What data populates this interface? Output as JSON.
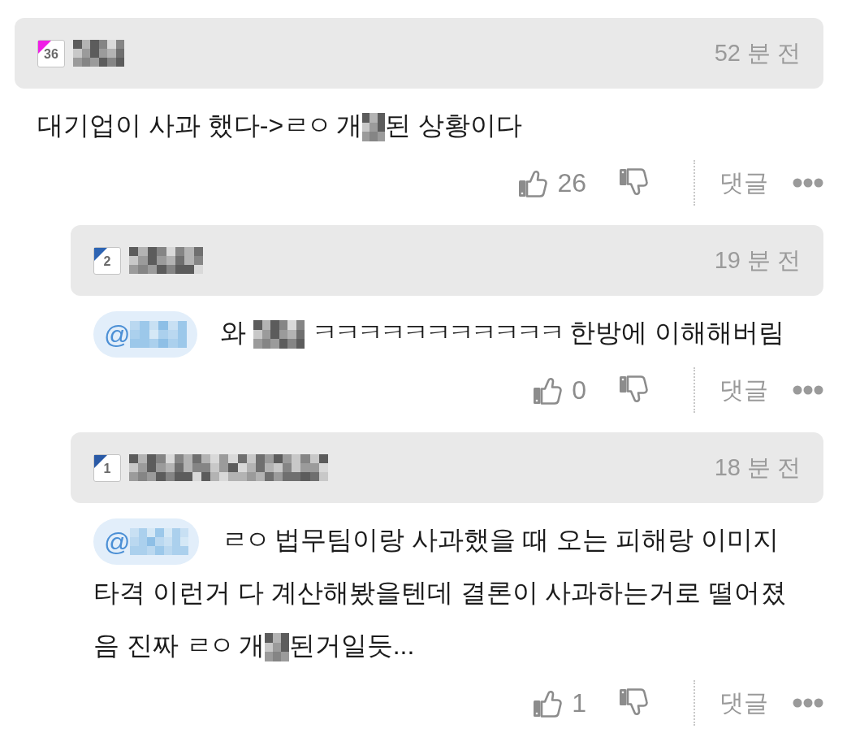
{
  "comments": [
    {
      "badge": {
        "text": "36",
        "color": "#f01ee6"
      },
      "time": "52 분 전",
      "body": [
        {
          "kind": "text",
          "text": "대기업이 사과 했다->ㄹㅇ 개"
        },
        {
          "kind": "mosaic"
        },
        {
          "kind": "text",
          "text": "된 상황이다"
        }
      ],
      "likes": "26",
      "reply_label": "댓글",
      "children": [
        {
          "badge": {
            "text": "2",
            "color": "#2d64b3"
          },
          "time": "19 분 전",
          "body": [
            {
              "kind": "mention",
              "text": "@"
            },
            {
              "kind": "text",
              "text": "와 "
            },
            {
              "kind": "mosaic"
            },
            {
              "kind": "text",
              "text": " ㅋㅋㅋㅋㅋㅋㅋㅋㅋㅋㅋ 한방에 이해해버림"
            }
          ],
          "likes": "0",
          "reply_label": "댓글"
        },
        {
          "badge": {
            "text": "1",
            "color": "#2a5aa6"
          },
          "time": "18 분 전",
          "body": [
            {
              "kind": "mention",
              "text": "@"
            },
            {
              "kind": "text",
              "text": "ㄹㅇ 법무팀이랑 사과했을 때 오는 피해랑 이미지 타격 이런거 다 계산해봤을텐데 결론이 사과하는거로 떨어졌음 진짜 ㄹㅇ 개"
            },
            {
              "kind": "mosaic"
            },
            {
              "kind": "text",
              "text": "된거일듯..."
            }
          ],
          "likes": "1",
          "reply_label": "댓글"
        }
      ]
    }
  ]
}
